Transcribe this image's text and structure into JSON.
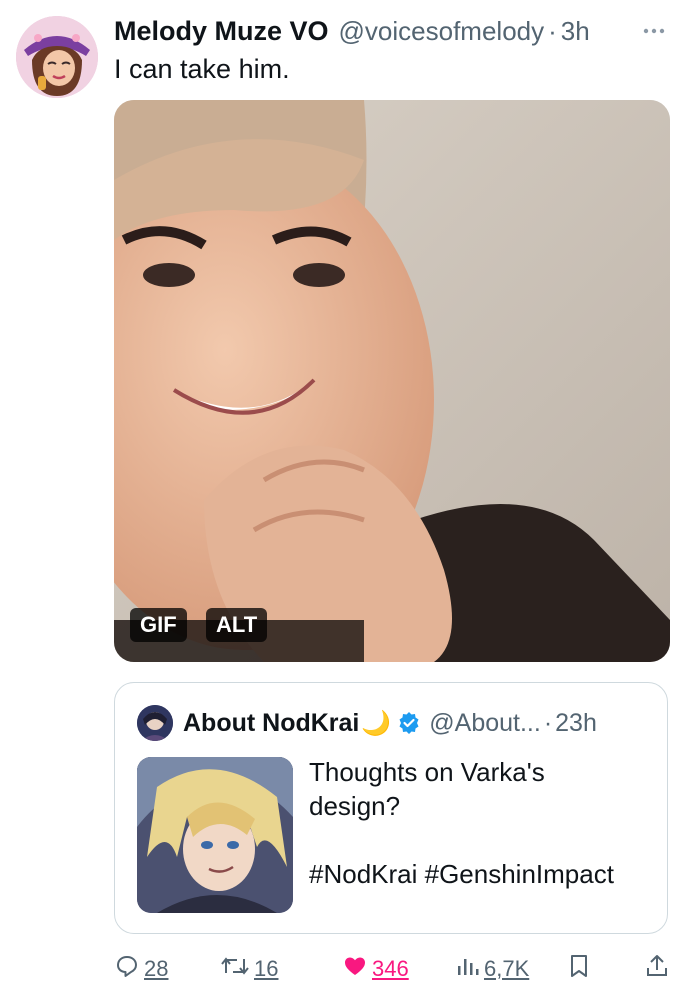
{
  "post": {
    "author_name": "Melody Muze VO",
    "author_handle": "@voicesofmelody",
    "separator": "·",
    "time": "3h",
    "text": "I can take him.",
    "media": {
      "badges": [
        "GIF",
        "ALT"
      ]
    }
  },
  "quoted": {
    "author_name": "About NodKrai",
    "name_emoji": "🌙",
    "author_handle": "@About...",
    "separator": "·",
    "time": "23h",
    "text_lines": [
      "Thoughts on Varka's",
      "design?"
    ],
    "hashtags": "#NodKrai #GenshinImpact"
  },
  "actions": {
    "replies": "28",
    "reposts": "16",
    "likes": "346",
    "views": "6,7K"
  },
  "colors": {
    "text_primary": "#0f1419",
    "text_secondary": "#536471",
    "like_pink": "#f91880",
    "verified_blue": "#1d9bf0",
    "border": "#cfd9de"
  },
  "icons": [
    "more-icon",
    "verified-badge-icon",
    "reply-icon",
    "repost-icon",
    "like-icon",
    "views-icon",
    "bookmark-icon",
    "share-icon"
  ]
}
